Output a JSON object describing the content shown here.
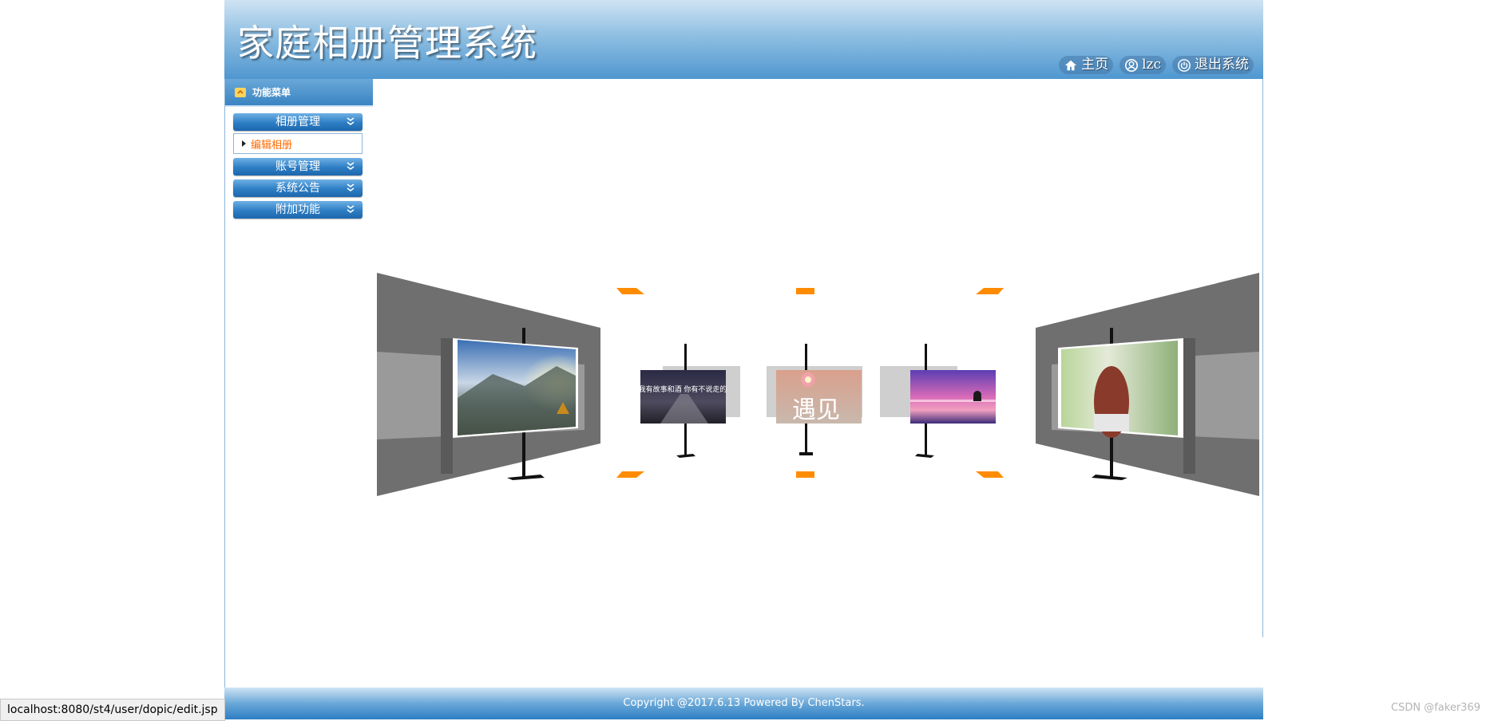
{
  "header": {
    "title": "家庭相册管理系统",
    "nav": [
      {
        "label": "主页",
        "icon": "home-icon"
      },
      {
        "label": "lzc",
        "icon": "user-icon"
      },
      {
        "label": "退出系统",
        "icon": "power-icon"
      }
    ]
  },
  "sidebar": {
    "title": "功能菜单",
    "menus": [
      {
        "label": "相册管理",
        "sub": "编辑相册"
      },
      {
        "label": "账号管理"
      },
      {
        "label": "系统公告"
      },
      {
        "label": "附加功能"
      }
    ]
  },
  "gallery": {
    "photos": [
      {
        "name": "photo-mountain-sunrise",
        "caption": ""
      },
      {
        "name": "photo-night-road",
        "caption": "我有故事和酒 你有不说走的"
      },
      {
        "name": "photo-hand-flower",
        "caption": "遇见"
      },
      {
        "name": "photo-purple-sunset",
        "caption": ""
      },
      {
        "name": "photo-girl-back",
        "caption": ""
      }
    ]
  },
  "footer": {
    "copyright": "Copyright @2017.6.13 Powered By ChenStars."
  },
  "status_bar": {
    "url": "localhost:8080/st4/user/dopic/edit.jsp"
  },
  "watermark": "CSDN @faker369",
  "colors": {
    "accent": "#2d7ec4",
    "submenu_text": "#ff6a00",
    "corner_marker": "#ff8c00"
  }
}
